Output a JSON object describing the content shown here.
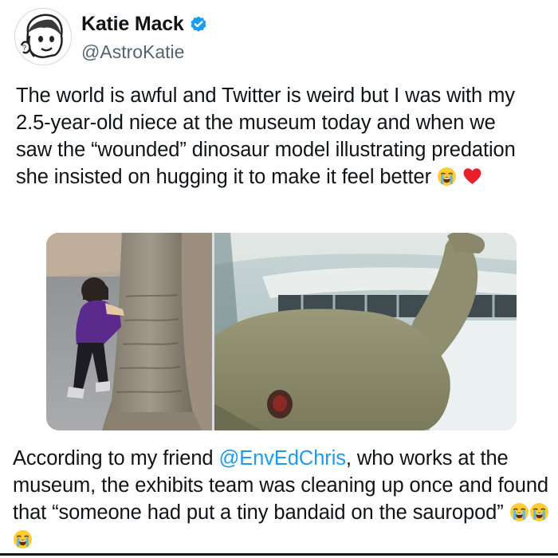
{
  "author": {
    "name": "Katie Mack",
    "handle": "@AstroKatie",
    "verified": true
  },
  "tweet": {
    "text": "The world is awful and Twitter is weird but I was with my 2.5-year-old niece at the museum today and when we saw the “wounded” dinosaur model illustrating predation she insisted on hugging it to make it feel better",
    "emojis": [
      "loudly-crying-face",
      "red-heart"
    ]
  },
  "media": [
    {
      "kind": "photo",
      "icon": "child-hugging-dinosaur-leg-photo"
    },
    {
      "kind": "photo",
      "icon": "sauropod-model-with-wound-photo"
    }
  ],
  "reply": {
    "text_before": "According to my friend ",
    "mention": "@EnvEdChris",
    "text_after": ", who works at the museum, the exhibits team was cleaning up once and found that “someone had put a tiny bandaid on the sauropod”",
    "emojis": [
      "loudly-crying-face",
      "loudly-crying-face",
      "loudly-crying-face"
    ]
  },
  "colors": {
    "accent": "#1d9bf0",
    "text": "#0f1419",
    "secondary": "#536471"
  }
}
